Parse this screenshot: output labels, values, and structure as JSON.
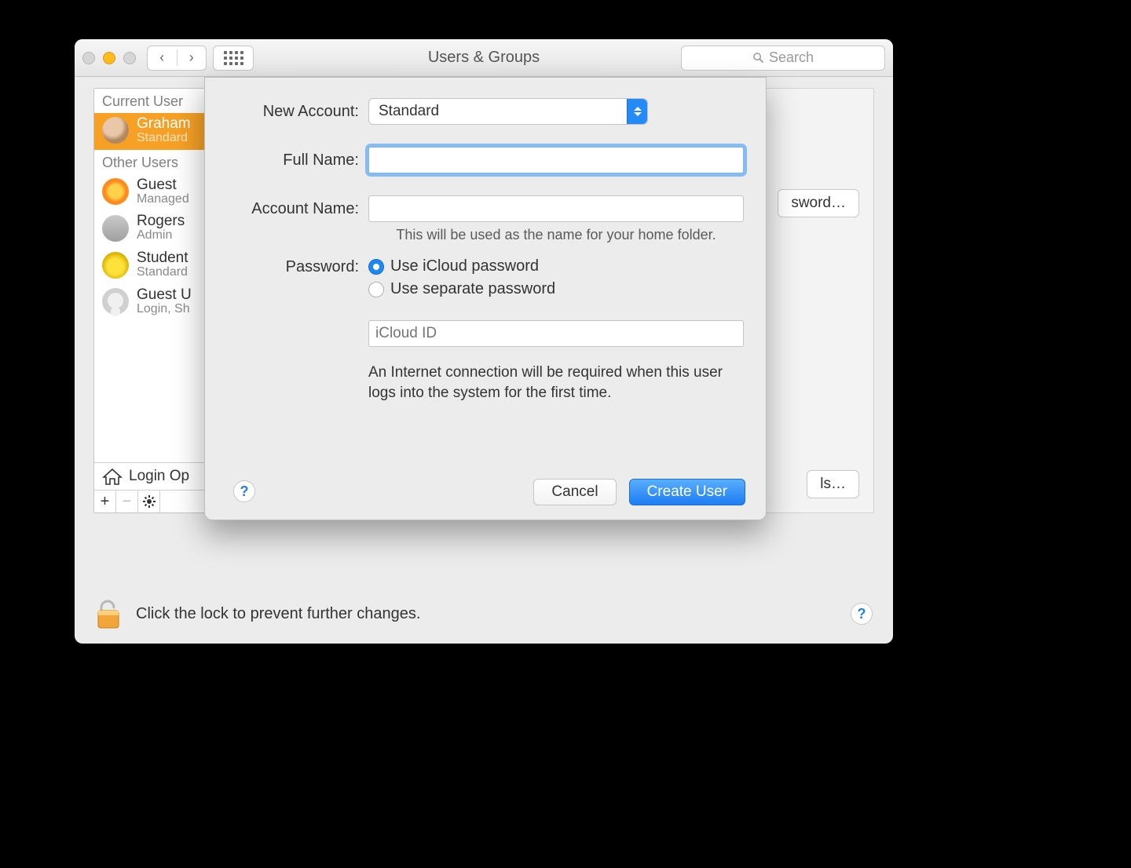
{
  "window": {
    "title": "Users & Groups",
    "search_placeholder": "Search"
  },
  "sidebar": {
    "current_header": "Current User",
    "other_header": "Other Users",
    "current": {
      "name": "Graham",
      "role": "Standard"
    },
    "others": [
      {
        "name": "Guest",
        "role": "Managed"
      },
      {
        "name": "Rogers",
        "role": "Admin"
      },
      {
        "name": "Student",
        "role": "Standard"
      },
      {
        "name": "Guest U",
        "role": "Login, Sh"
      }
    ],
    "login_options_label": "Login Op"
  },
  "main_behind": {
    "top_button_fragment": "sword…",
    "bottom_button_fragment": "ls…"
  },
  "footer": {
    "lock_text": "Click the lock to prevent further changes."
  },
  "sheet": {
    "labels": {
      "new_account": "New Account:",
      "full_name": "Full Name:",
      "account_name": "Account Name:",
      "password": "Password:"
    },
    "account_type_selected": "Standard",
    "full_name_value": "",
    "account_name_value": "",
    "account_name_hint": "This will be used as the name for your home folder.",
    "radio_icloud": "Use iCloud password",
    "radio_separate": "Use separate password",
    "password_mode": "icloud",
    "icloud_id_placeholder": "iCloud ID",
    "icloud_id_value": "",
    "note": "An Internet connection will be required when this user logs into the system for the first time.",
    "cancel": "Cancel",
    "create": "Create User"
  }
}
